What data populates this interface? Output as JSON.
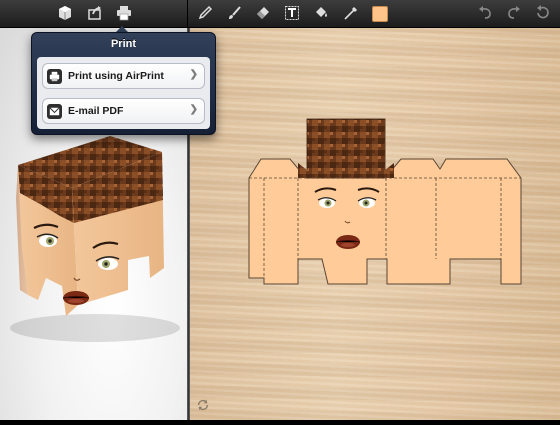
{
  "toolbar": {
    "left_icons": [
      "cube-icon",
      "share-icon",
      "print-icon"
    ],
    "tools": [
      "pencil-icon",
      "brush-icon",
      "eraser-icon",
      "text-tool-icon",
      "fill-bucket-icon",
      "eyedropper-icon",
      "color-swatch"
    ],
    "history": [
      "undo-icon",
      "redo-icon",
      "revert-icon"
    ],
    "current_color": "#ffc48a"
  },
  "popover": {
    "title": "Print",
    "items": [
      {
        "label": "Print using AirPrint",
        "icon": "printer-icon"
      },
      {
        "label": "E-mail PDF",
        "icon": "mail-icon"
      }
    ]
  },
  "colors": {
    "skin": "#ffcc99",
    "hair": "#6b3a1d",
    "toolbar": "#2a2a2a",
    "popover": "#1f2b44"
  }
}
